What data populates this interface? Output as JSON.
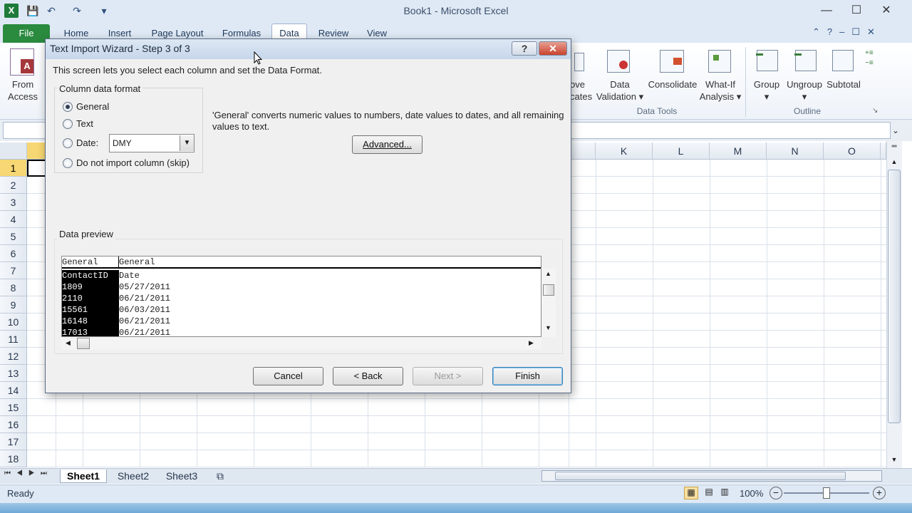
{
  "window": {
    "title": "Book1  -  Microsoft Excel"
  },
  "qat": {
    "excel_icon": "X",
    "save": "💾",
    "undo": "↶",
    "redo": "↷",
    "customize": "▾"
  },
  "window_controls": {
    "minimize": "—",
    "maximize": "☐",
    "close": "✕"
  },
  "ribbon_tabs": [
    "File",
    "Home",
    "Insert",
    "Page Layout",
    "Formulas",
    "Data",
    "Review",
    "View"
  ],
  "ribbon": {
    "from_access": [
      "From",
      "Access"
    ],
    "remove_duplicates": [
      "ove",
      "cates"
    ],
    "data_validation": [
      "Data",
      "Validation ▾"
    ],
    "consolidate": "Consolidate",
    "what_if": [
      "What-If",
      "Analysis ▾"
    ],
    "group": "Group",
    "ungroup": "Ungroup",
    "subtotal": "Subtotal",
    "data_tools_label": "Data Tools",
    "outline_label": "Outline"
  },
  "grid": {
    "columns": [
      "K",
      "L",
      "M",
      "N",
      "O"
    ],
    "rows": [
      "1",
      "2",
      "3",
      "4",
      "5",
      "6",
      "7",
      "8",
      "9",
      "10",
      "11",
      "12",
      "13",
      "14",
      "15",
      "16",
      "17",
      "18"
    ]
  },
  "sheets": [
    "Sheet1",
    "Sheet2",
    "Sheet3"
  ],
  "status": {
    "ready": "Ready",
    "zoom": "100%"
  },
  "dialog": {
    "title": "Text Import Wizard - Step 3 of 3",
    "help": "?",
    "close": "✕",
    "intro": "This screen lets you select each column and set the Data Format.",
    "column_format_label": "Column data format",
    "options": {
      "general": "General",
      "text": "Text",
      "date": "Date:",
      "skip": "Do not import column (skip)"
    },
    "selected_option": "General",
    "date_value": "DMY",
    "description": "'General' converts numeric values to numbers, date values to dates, and all remaining values to text.",
    "advanced_button": "Advanced...",
    "preview_label": "Data preview",
    "preview": {
      "headers": [
        "General",
        "General"
      ],
      "rows": [
        [
          "ContactID",
          "Date"
        ],
        [
          "1809",
          "05/27/2011"
        ],
        [
          "2110",
          "06/21/2011"
        ],
        [
          "15561",
          "06/03/2011"
        ],
        [
          "16148",
          "06/21/2011"
        ],
        [
          "17013",
          "06/21/2011"
        ]
      ]
    },
    "buttons": {
      "cancel": "Cancel",
      "back": "< Back",
      "next": "Next >",
      "finish": "Finish"
    }
  }
}
